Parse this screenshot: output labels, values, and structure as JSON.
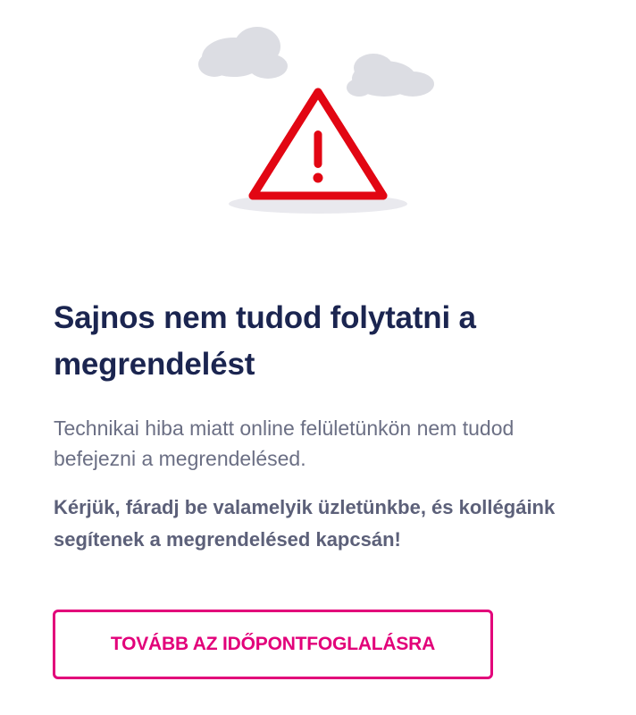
{
  "illustration": {
    "icon": "warning-triangle-icon",
    "accent_color": "#e20613",
    "cloud_color": "#dcdde3"
  },
  "error": {
    "title": "Sajnos nem tudod folytatni a megrendelést",
    "message": "Technikai hiba miatt online felületünkön nem tudod befejezni a megrendelésed.",
    "instruction": "Kérjük, fáradj be valamelyik üzletünkbe, és kollégáink segítenek a megrendelésed kapcsán!"
  },
  "actions": {
    "continue_label": "TOVÁBB AZ IDŐPONTFOGLALÁSRA",
    "accent_color": "#e2007a"
  }
}
